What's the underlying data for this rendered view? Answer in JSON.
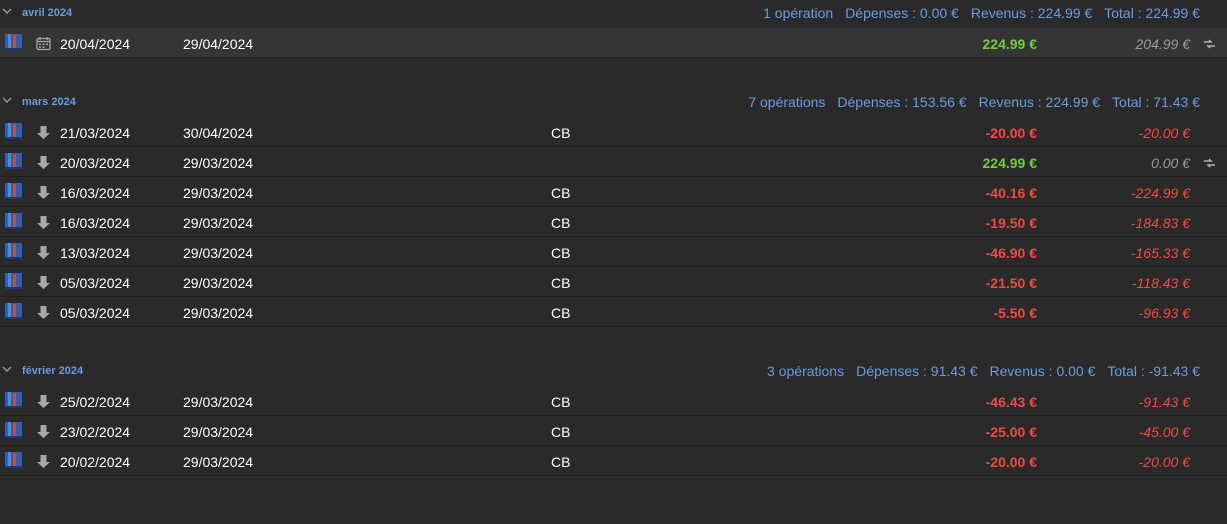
{
  "groups": [
    {
      "title": "avril 2024",
      "ops": "1 opération",
      "depenses": "Dépenses : 0.00 €",
      "revenus": "Revenus : 224.99 €",
      "total": "Total : 224.99 €",
      "rows": [
        {
          "type_icon": "calendar-icon",
          "date": "20/04/2024",
          "value_date": "29/04/2024",
          "mode": "",
          "amount": "224.99 €",
          "amount_kind": "positive",
          "balance": "204.99 €",
          "balance_kind": "neutral",
          "linked": true,
          "selected": true
        }
      ]
    },
    {
      "title": "mars 2024",
      "ops": "7 opérations",
      "depenses": "Dépenses : 153.56 €",
      "revenus": "Revenus : 224.99 €",
      "total": "Total : 71.43 €",
      "rows": [
        {
          "type_icon": "arrow-down-icon",
          "date": "21/03/2024",
          "value_date": "30/04/2024",
          "mode": "CB",
          "amount": "-20.00 €",
          "amount_kind": "negative",
          "balance": "-20.00 €",
          "balance_kind": "negative",
          "linked": false
        },
        {
          "type_icon": "arrow-down-icon",
          "date": "20/03/2024",
          "value_date": "29/03/2024",
          "mode": "",
          "amount": "224.99 €",
          "amount_kind": "positive",
          "balance": "0.00 €",
          "balance_kind": "neutral",
          "linked": true
        },
        {
          "type_icon": "arrow-down-icon",
          "date": "16/03/2024",
          "value_date": "29/03/2024",
          "mode": "CB",
          "amount": "-40.16 €",
          "amount_kind": "negative",
          "balance": "-224.99 €",
          "balance_kind": "negative",
          "linked": false
        },
        {
          "type_icon": "arrow-down-icon",
          "date": "16/03/2024",
          "value_date": "29/03/2024",
          "mode": "CB",
          "amount": "-19.50 €",
          "amount_kind": "negative",
          "balance": "-184.83 €",
          "balance_kind": "negative",
          "linked": false
        },
        {
          "type_icon": "arrow-down-icon",
          "date": "13/03/2024",
          "value_date": "29/03/2024",
          "mode": "CB",
          "amount": "-46.90 €",
          "amount_kind": "negative",
          "balance": "-165.33 €",
          "balance_kind": "negative",
          "linked": false
        },
        {
          "type_icon": "arrow-down-icon",
          "date": "05/03/2024",
          "value_date": "29/03/2024",
          "mode": "CB",
          "amount": "-21.50 €",
          "amount_kind": "negative",
          "balance": "-118.43 €",
          "balance_kind": "negative",
          "linked": false
        },
        {
          "type_icon": "arrow-down-icon",
          "date": "05/03/2024",
          "value_date": "29/03/2024",
          "mode": "CB",
          "amount": "-5.50 €",
          "amount_kind": "negative",
          "balance": "-96.93 €",
          "balance_kind": "negative",
          "linked": false
        }
      ]
    },
    {
      "title": "février 2024",
      "ops": "3 opérations",
      "depenses": "Dépenses : 91.43 €",
      "revenus": "Revenus : 0.00 €",
      "total": "Total : -91.43 €",
      "rows": [
        {
          "type_icon": "arrow-down-icon",
          "date": "25/02/2024",
          "value_date": "29/03/2024",
          "mode": "CB",
          "amount": "-46.43 €",
          "amount_kind": "negative",
          "balance": "-91.43 €",
          "balance_kind": "negative",
          "linked": false
        },
        {
          "type_icon": "arrow-down-icon",
          "date": "23/02/2024",
          "value_date": "29/03/2024",
          "mode": "CB",
          "amount": "-25.00 €",
          "amount_kind": "negative",
          "balance": "-45.00 €",
          "balance_kind": "negative",
          "linked": false
        },
        {
          "type_icon": "arrow-down-icon",
          "date": "20/02/2024",
          "value_date": "29/03/2024",
          "mode": "CB",
          "amount": "-20.00 €",
          "amount_kind": "negative",
          "balance": "-20.00 €",
          "balance_kind": "negative",
          "linked": false
        }
      ]
    }
  ],
  "colors": {
    "background": "#2a2a2a",
    "header_text": "#6a9ce0",
    "positive": "#6fcf3e",
    "negative": "#ef4a45",
    "neutral_balance": "#9a9a9a"
  }
}
